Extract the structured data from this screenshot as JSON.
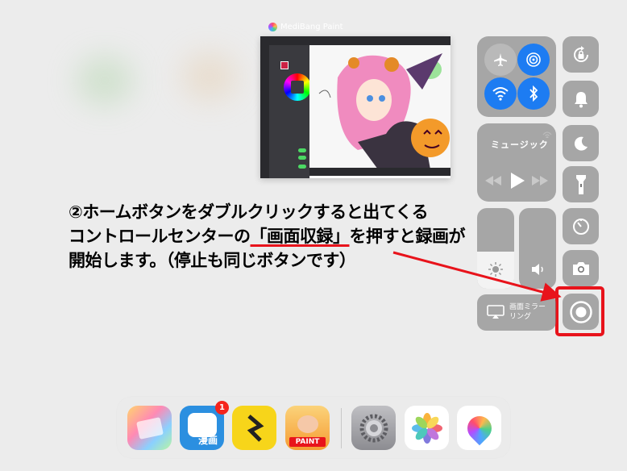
{
  "app_switcher": {
    "app_name": "MediBang Paint"
  },
  "control_center": {
    "music_label": "ミュージック",
    "screen_mirroring_label": "画面ミラー\nリング"
  },
  "annotation": {
    "line1": "②ホームボタンをダブルクリックすると出てくる",
    "line2_prefix": "コントロールセンターの",
    "line2_highlight": "「画面収録」",
    "line2_suffix": "を押すと録画が",
    "line3": "開始します。（停止も同じボタンです）"
  },
  "dock": {
    "manga_app_label": "漫画",
    "manga_badge_count": "1",
    "jump_paint_label": "PAINT",
    "icons": [
      "pastel-app",
      "manga-app",
      "yellow-s-app",
      "jump-paint-app",
      "settings",
      "photos",
      "medibang-paint"
    ]
  },
  "colors": {
    "accent_blue": "#1d7cf2",
    "highlight_red": "#e8131b",
    "toggle_green": "#4cd964"
  }
}
